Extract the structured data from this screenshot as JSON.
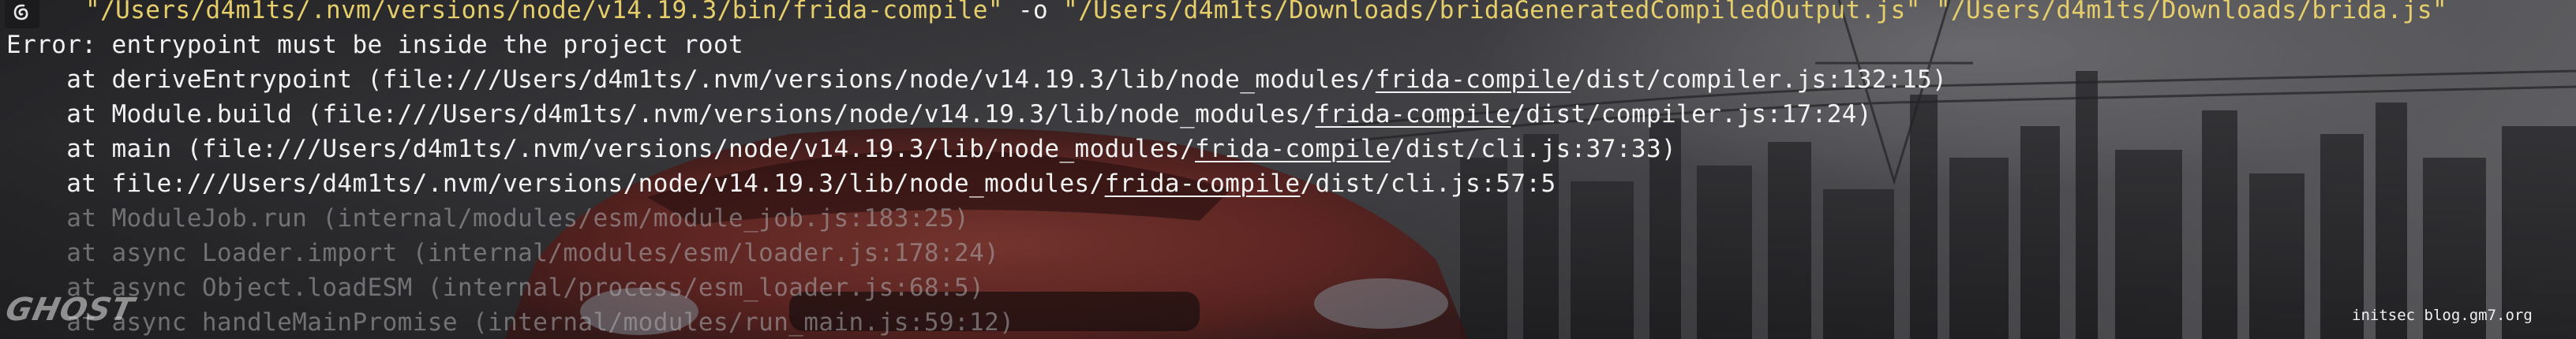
{
  "terminal": {
    "command": {
      "arg_compiler": "\"/Users/d4m1ts/.nvm/versions/node/v14.19.3/bin/frida-compile\"",
      "flag_o": " -o ",
      "arg_output": "\"/Users/d4m1ts/Downloads/bridaGeneratedCompiledOutput.js\"",
      "arg_input": " \"/Users/d4m1ts/Downloads/brida.js\""
    },
    "error_line": "Error: entrypoint must be inside the project root",
    "stack": [
      {
        "prefix": "    at deriveEntrypoint (file:///Users/d4m1ts/.nvm/versions/node/v14.19.3/lib/node_modules/",
        "module": "frida-compile",
        "suffix": "/dist/compiler.js:132:15)"
      },
      {
        "prefix": "    at Module.build (file:///Users/d4m1ts/.nvm/versions/node/v14.19.3/lib/node_modules/",
        "module": "frida-compile",
        "suffix": "/dist/compiler.js:17:24)"
      },
      {
        "prefix": "    at main (file:///Users/d4m1ts/.nvm/versions/node/v14.19.3/lib/node_modules/",
        "module": "frida-compile",
        "suffix": "/dist/cli.js:37:33)"
      },
      {
        "prefix": "    at file:///Users/d4m1ts/.nvm/versions/node/v14.19.3/lib/node_modules/",
        "module": "frida-compile",
        "suffix": "/dist/cli.js:57:5"
      }
    ],
    "internal_stack": [
      "    at ModuleJob.run (internal/modules/esm/module_job.js:183:25)",
      "    at async Loader.import (internal/modules/esm/loader.js:178:24)",
      "    at async Object.loadESM (internal/process/esm_loader.js:68:5)",
      "    at async handleMainPromise (internal/modules/run_main.js:59:12)"
    ]
  },
  "branding": {
    "wallpaper_logo": "GHOST",
    "watermark": "initsec blog.gm7.org"
  },
  "icons": {
    "prompt": "debian-swirl-icon"
  },
  "colors": {
    "command_text": "#e6cf6a",
    "error_text": "#f2f2f2",
    "internal_text": "#9a9a9c",
    "car_body": "#b83a2e"
  }
}
